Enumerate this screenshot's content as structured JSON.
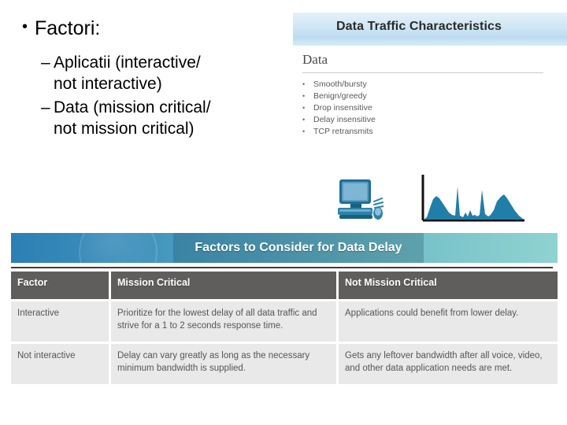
{
  "slide": {
    "heading": "Factori:",
    "bullet_glyph": "•",
    "dash_glyph": "–",
    "sub_bullets": [
      "Aplicatii (interactive/\nnot interactive)",
      "Data (mission critical/\nnot mission critical)"
    ]
  },
  "info_panel": {
    "title": "Data Traffic Characteristics",
    "section_heading": "Data",
    "bullet_glyph": "•",
    "items": [
      "Smooth/bursty",
      "Benign/greedy",
      "Drop insensitive",
      "Delay insensitive",
      "TCP retransmits"
    ]
  },
  "graphics": {
    "computer_icon_name": "desktop-computer-icon",
    "chart_name": "bursty-traffic-chart",
    "chart_color": "#1f7fa8"
  },
  "table": {
    "banner_title": "Factors to Consider for Data Delay",
    "banner_gradient_start": "#2b7fb4",
    "banner_gradient_end": "#8fd2d2",
    "header_background": "#605d5d",
    "cell_background": "#e9e9e9",
    "columns": [
      "Factor",
      "Mission Critical",
      "Not Mission Critical"
    ],
    "rows": [
      {
        "factor": "Interactive",
        "mission_critical": "Prioritize for the lowest delay of all data traffic and strive for a 1 to 2 seconds response time.",
        "not_mission_critical": "Applications could benefit from lower delay."
      },
      {
        "factor": "Not interactive",
        "mission_critical": "Delay can vary greatly as long as the necessary minimum bandwidth is supplied.",
        "not_mission_critical": "Gets any leftover bandwidth after all voice, video, and other data application needs are met."
      }
    ]
  },
  "chart_data": {
    "type": "area",
    "title": "",
    "xlabel": "",
    "ylabel": "",
    "x": [
      0,
      1,
      2,
      3,
      4,
      5,
      6,
      7,
      8,
      9,
      10,
      11,
      12,
      13,
      14,
      15,
      16,
      17,
      18,
      19,
      20,
      21,
      22,
      23,
      24,
      25,
      26,
      27,
      28,
      29,
      30
    ],
    "values": [
      2,
      4,
      18,
      34,
      40,
      36,
      28,
      20,
      14,
      10,
      8,
      62,
      30,
      9,
      6,
      14,
      7,
      16,
      8,
      7,
      10,
      58,
      30,
      10,
      7,
      14,
      30,
      46,
      52,
      40,
      16
    ],
    "ylim": [
      0,
      70
    ],
    "grid": false,
    "legend": null,
    "series_color": "#1f7fa8"
  }
}
